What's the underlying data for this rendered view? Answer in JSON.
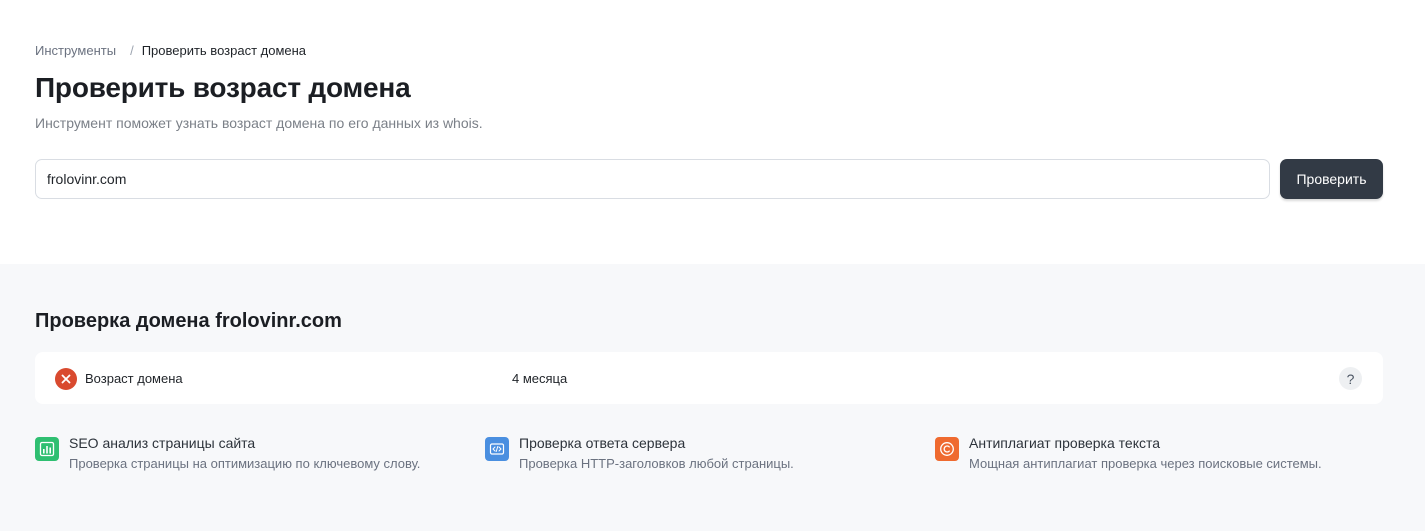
{
  "breadcrumb": {
    "root": "Инструменты",
    "separator": "/",
    "current": "Проверить возраст домена"
  },
  "header": {
    "title": "Проверить возраст домена",
    "subtitle": "Инструмент поможет узнать возраст домена по его данных из whois."
  },
  "form": {
    "domain_value": "frolovinr.com",
    "submit_label": "Проверить"
  },
  "result": {
    "title": "Проверка домена frolovinr.com",
    "row": {
      "status": "error",
      "status_icon": "close-icon",
      "label": "Возраст домена",
      "value": "4 месяца",
      "help": "?"
    }
  },
  "tools": [
    {
      "icon": "bar-chart-icon",
      "color": "#2fbf71",
      "name": "SEO анализ страницы сайта",
      "desc": "Проверка страницы на оптимизацию по ключевому слову."
    },
    {
      "icon": "code-icon",
      "color": "#4a8fe0",
      "name": "Проверка ответа сервера",
      "desc": "Проверка HTTP-заголовков любой страницы."
    },
    {
      "icon": "copyright-icon",
      "color": "#ef6a2f",
      "name": "Антиплагиат проверка текста",
      "desc": "Мощная антиплагиат проверка через поисковые системы."
    }
  ],
  "colors": {
    "primary_button": "#323a45",
    "error": "#d94a2f",
    "section_bg": "#f7f8fa"
  }
}
